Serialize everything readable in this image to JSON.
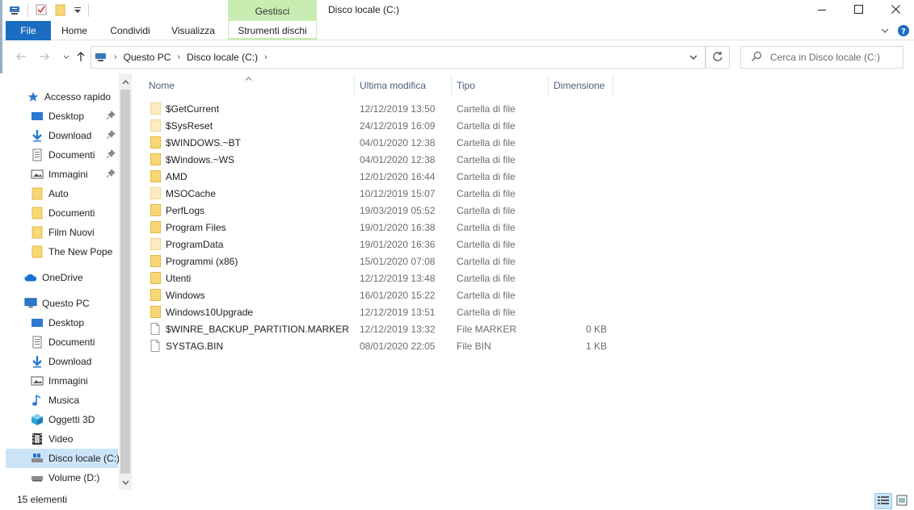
{
  "window": {
    "title": "Disco locale (C:)",
    "contextual_tab_header": "Gestisci",
    "controls": {
      "minimize_icon": "minimize-icon",
      "maximize_icon": "maximize-icon",
      "close_icon": "close-icon"
    }
  },
  "ribbon": {
    "tabs": [
      "File",
      "Home",
      "Condividi",
      "Visualizza",
      "Strumenti dischi"
    ],
    "help_icon": "help-icon",
    "expand_icon": "chevron-down-icon"
  },
  "address": {
    "breadcrumb": [
      "Questo PC",
      "Disco locale (C:)"
    ],
    "search_placeholder": "Cerca in Disco locale (C:)"
  },
  "nav_pane": {
    "items": [
      {
        "label": "Accesso rapido",
        "icon": "star-icon",
        "pinned": false
      },
      {
        "label": "Desktop",
        "icon": "desktop-icon",
        "pinned": true
      },
      {
        "label": "Download",
        "icon": "download-icon",
        "pinned": true
      },
      {
        "label": "Documenti",
        "icon": "document-icon",
        "pinned": true
      },
      {
        "label": "Immagini",
        "icon": "pictures-icon",
        "pinned": true
      },
      {
        "label": "Auto",
        "icon": "folder-icon",
        "pinned": false
      },
      {
        "label": "Documenti",
        "icon": "folder-icon",
        "pinned": false
      },
      {
        "label": "Film Nuovi",
        "icon": "folder-icon",
        "pinned": false
      },
      {
        "label": "The New Pope",
        "icon": "folder-icon",
        "pinned": false
      },
      {
        "label": "OneDrive",
        "icon": "cloud-icon",
        "pinned": false
      },
      {
        "label": "Questo PC",
        "icon": "computer-icon",
        "pinned": false
      },
      {
        "label": "Desktop",
        "icon": "desktop-icon",
        "pinned": false
      },
      {
        "label": "Documenti",
        "icon": "document-icon",
        "pinned": false
      },
      {
        "label": "Download",
        "icon": "download-icon",
        "pinned": false
      },
      {
        "label": "Immagini",
        "icon": "pictures-icon",
        "pinned": false
      },
      {
        "label": "Musica",
        "icon": "music-icon",
        "pinned": false
      },
      {
        "label": "Oggetti 3D",
        "icon": "cube-icon",
        "pinned": false
      },
      {
        "label": "Video",
        "icon": "video-icon",
        "pinned": false
      },
      {
        "label": "Disco locale (C:)",
        "icon": "drive-icon",
        "pinned": false,
        "selected": true
      },
      {
        "label": "Volume (D:)",
        "icon": "drive-icon",
        "pinned": false
      }
    ]
  },
  "file_list": {
    "columns": [
      "Nome",
      "Ultima modifica",
      "Tipo",
      "Dimensione"
    ],
    "sorted_by": "Nome",
    "rows": [
      {
        "name": "$GetCurrent",
        "modified": "12/12/2019 13:50",
        "type": "Cartella di file",
        "size": "",
        "icon": "folder-faded-icon"
      },
      {
        "name": "$SysReset",
        "modified": "24/12/2019 16:09",
        "type": "Cartella di file",
        "size": "",
        "icon": "folder-faded-icon"
      },
      {
        "name": "$WINDOWS.~BT",
        "modified": "04/01/2020 12:38",
        "type": "Cartella di file",
        "size": "",
        "icon": "folder-icon"
      },
      {
        "name": "$Windows.~WS",
        "modified": "04/01/2020 12:38",
        "type": "Cartella di file",
        "size": "",
        "icon": "folder-icon"
      },
      {
        "name": "AMD",
        "modified": "12/01/2020 16:44",
        "type": "Cartella di file",
        "size": "",
        "icon": "folder-icon"
      },
      {
        "name": "MSOCache",
        "modified": "10/12/2019 15:07",
        "type": "Cartella di file",
        "size": "",
        "icon": "folder-faded-icon"
      },
      {
        "name": "PerfLogs",
        "modified": "19/03/2019 05:52",
        "type": "Cartella di file",
        "size": "",
        "icon": "folder-icon"
      },
      {
        "name": "Program Files",
        "modified": "19/01/2020 16:38",
        "type": "Cartella di file",
        "size": "",
        "icon": "folder-icon"
      },
      {
        "name": "ProgramData",
        "modified": "19/01/2020 16:36",
        "type": "Cartella di file",
        "size": "",
        "icon": "folder-faded-icon"
      },
      {
        "name": "Programmi (x86)",
        "modified": "15/01/2020 07:08",
        "type": "Cartella di file",
        "size": "",
        "icon": "folder-icon"
      },
      {
        "name": "Utenti",
        "modified": "12/12/2019 13:48",
        "type": "Cartella di file",
        "size": "",
        "icon": "folder-icon"
      },
      {
        "name": "Windows",
        "modified": "16/01/2020 15:22",
        "type": "Cartella di file",
        "size": "",
        "icon": "folder-icon"
      },
      {
        "name": "Windows10Upgrade",
        "modified": "12/12/2019 13:51",
        "type": "Cartella di file",
        "size": "",
        "icon": "folder-icon"
      },
      {
        "name": "$WINRE_BACKUP_PARTITION.MARKER",
        "modified": "12/12/2019 13:32",
        "type": "File MARKER",
        "size": "0 KB",
        "icon": "file-icon"
      },
      {
        "name": "SYSTAG.BIN",
        "modified": "08/01/2020 22:05",
        "type": "File BIN",
        "size": "1 KB",
        "icon": "file-icon"
      }
    ]
  },
  "status_bar": {
    "item_count": "15 elementi",
    "view_icons": [
      "details-view-icon",
      "large-icons-view-icon"
    ]
  },
  "colors": {
    "file_tab": "#1a6dc1",
    "contextual_tab": "#c9ecb3",
    "selection": "#cce4f7",
    "folder": "#f8d775",
    "folder_faded": "#fbecc1",
    "column_header_text": "#4c607a",
    "meta_text": "#6d6d6d"
  }
}
